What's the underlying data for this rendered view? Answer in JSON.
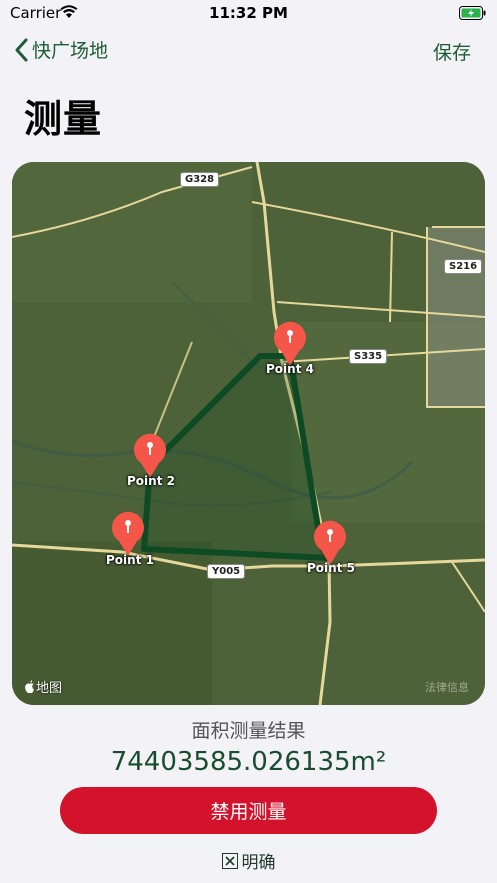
{
  "status_bar": {
    "carrier": "Carrier",
    "time": "11:32 PM"
  },
  "nav": {
    "back_label": "快广场地",
    "save_label": "保存"
  },
  "page_title": "测量",
  "map": {
    "roads": [
      "G328",
      "S216",
      "S335",
      "Y005"
    ],
    "points": [
      "Point 4",
      "Point 2",
      "Point 1",
      "Point 5"
    ],
    "maps_label": "地图",
    "legal_label": "法律信息"
  },
  "result": {
    "label": "面积测量结果",
    "value": "74403585.026135m²"
  },
  "actions": {
    "disable_label": "禁用测量",
    "clarify_label": "明确"
  },
  "colors": {
    "accent": "#1d5c34",
    "danger": "#d2132b",
    "polygon": "#0e4a24",
    "pin": "#f4564a"
  }
}
